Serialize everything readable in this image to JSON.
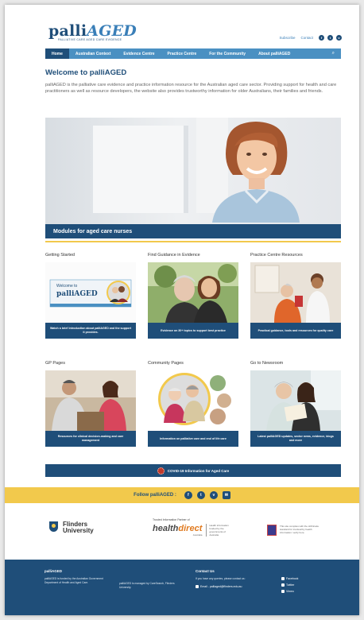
{
  "header": {
    "logo_main": "palli",
    "logo_accent": "AGED",
    "logo_tagline": "PALLIATIVE CARE AGED CARE EVIDENCE",
    "subscribe": "Subscribe",
    "contact": "Contact",
    "social": [
      "f",
      "t",
      "v"
    ]
  },
  "nav": {
    "items": [
      "Home",
      "Australian Context",
      "Evidence Centre",
      "Practice Centre",
      "For the Community",
      "About palliAGED"
    ],
    "search_glyph": "⌕"
  },
  "welcome": {
    "title": "Welcome to palliAGED",
    "body": "palliAGED is the palliative care evidence and practice information resource for the Australian aged care sector. Providing support for health and care practitioners as well as resource developers, the website also provides trustworthy information for older Australians, their families and friends."
  },
  "hero": {
    "caption": "Modules for aged care nurses"
  },
  "cards": [
    {
      "title": "Getting Started",
      "caption": "Watch a brief introduction about palliAGED and the support it provides.",
      "video_text": "Welcome to",
      "video_logo": "palliAGED"
    },
    {
      "title": "Find Guidance in Evidence",
      "caption": "Evidence on 30+ topics to support best practice"
    },
    {
      "title": "Practice Centre Resources",
      "caption": "Practical guidance, tools and resources for quality care"
    },
    {
      "title": "GP Pages",
      "caption": "Resources for clinical decision-making and care management"
    },
    {
      "title": "Community Pages",
      "caption": "Information on palliative care and end of life care"
    },
    {
      "title": "Go to Newsroom",
      "caption": "Latest palliAGED updates, sector news, evidence, blogs and more"
    }
  ],
  "covid": {
    "label": "COVID-19 Information for Aged Care"
  },
  "follow": {
    "label": "Follow palliAGED :",
    "icons": [
      "f",
      "t",
      "v",
      "✉"
    ]
  },
  "partners": {
    "flinders_line1": "Flinders",
    "flinders_line2": "University",
    "hd_label": "Trusted Information Partner of",
    "hd_logo_a": "health",
    "hd_logo_b": "direct",
    "hd_sub": "Australia",
    "hd_note": "Health information funded by the governments of Australia",
    "gov_text": "This site complies with the HONcode standard for trustworthy health information: verify here."
  },
  "footer": {
    "col1_title": "palliAGED",
    "col1_text": "palliAGED is funded by the Australian Government Department of Health and Aged Care.",
    "col2_text": "palliAGED is managed by CareSearch, Flinders University.",
    "col3_title": "Contact Us",
    "col3_text": "If you have any queries, please contact us:",
    "col3_email": "Email - palliaged@flinders.edu.au",
    "links": [
      "Facebook",
      "Twitter",
      "Vimeo"
    ]
  },
  "colors": {
    "primary": "#1f4e79",
    "nav": "#4a90c2",
    "accent": "#f2c94c"
  }
}
